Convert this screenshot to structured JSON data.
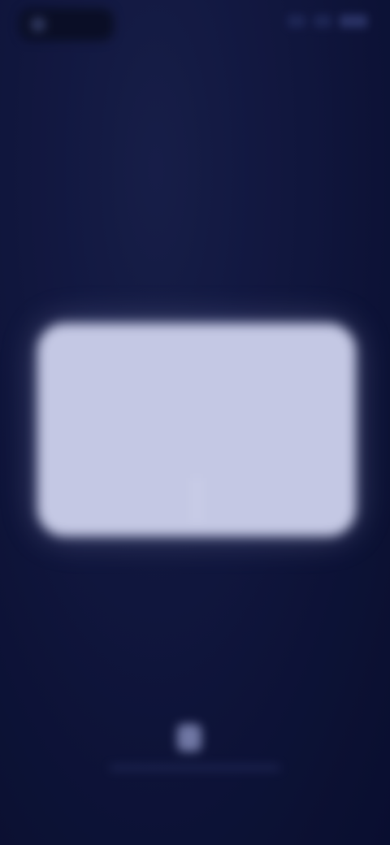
{
  "status_bar": {
    "icons": [
      "signal-icon",
      "wifi-icon",
      "battery-icon"
    ]
  },
  "dialog": {
    "title": "",
    "body": "",
    "primary_button": "",
    "secondary_button": ""
  },
  "brand": {
    "name": "",
    "icon": "logo-icon"
  },
  "colors": {
    "background": "#111845",
    "dialog": "#c4c8e4",
    "dialog_text": "#4a507a"
  }
}
